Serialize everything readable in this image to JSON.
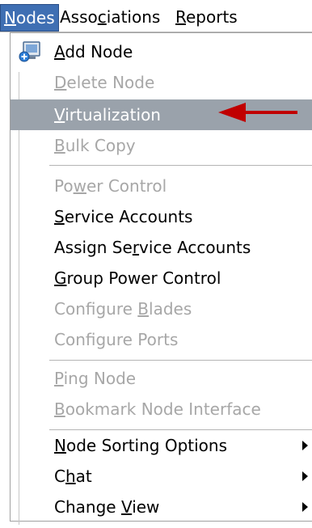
{
  "menubar": {
    "items": [
      {
        "label": "Nodes",
        "underline_index": 0,
        "active": true
      },
      {
        "label": "Associations",
        "underline_index": 4,
        "active": false
      },
      {
        "label": "Reports",
        "underline_index": 0,
        "active": false
      }
    ]
  },
  "dropdown": {
    "groups": [
      [
        {
          "label": "Add Node",
          "underline_index": 0,
          "enabled": true,
          "icon": "add-node-icon"
        },
        {
          "label": "Delete Node",
          "underline_index": 0,
          "enabled": false
        },
        {
          "label": "Virtualization",
          "underline_index": 0,
          "enabled": true,
          "highlighted": true
        },
        {
          "label": "Bulk Copy",
          "underline_index": 0,
          "enabled": false
        }
      ],
      [
        {
          "label": "Power Control",
          "underline_index": 2,
          "enabled": false
        },
        {
          "label": "Service Accounts",
          "underline_index": 0,
          "enabled": true
        },
        {
          "label": "Assign Service Accounts",
          "underline_index": 9,
          "enabled": true
        },
        {
          "label": "Group Power Control",
          "underline_index": 0,
          "enabled": true
        },
        {
          "label": "Configure Blades",
          "underline_index": 10,
          "enabled": false
        },
        {
          "label": "Configure Ports",
          "underline_index": -1,
          "enabled": false
        }
      ],
      [
        {
          "label": "Ping Node",
          "underline_index": 0,
          "enabled": false
        },
        {
          "label": "Bookmark Node Interface",
          "underline_index": 0,
          "enabled": false
        }
      ],
      [
        {
          "label": "Node Sorting Options",
          "underline_index": 0,
          "enabled": true,
          "submenu": true
        },
        {
          "label": "Chat",
          "underline_index": 1,
          "enabled": true,
          "submenu": true
        },
        {
          "label": "Change View",
          "underline_index": 7,
          "enabled": true,
          "submenu": true
        }
      ]
    ]
  },
  "colors": {
    "highlight_bg": "#9aa2ab",
    "active_menu_bg": "#3f6fb3",
    "disabled_text": "#a7a7a7",
    "annotation_arrow": "#c00000"
  }
}
